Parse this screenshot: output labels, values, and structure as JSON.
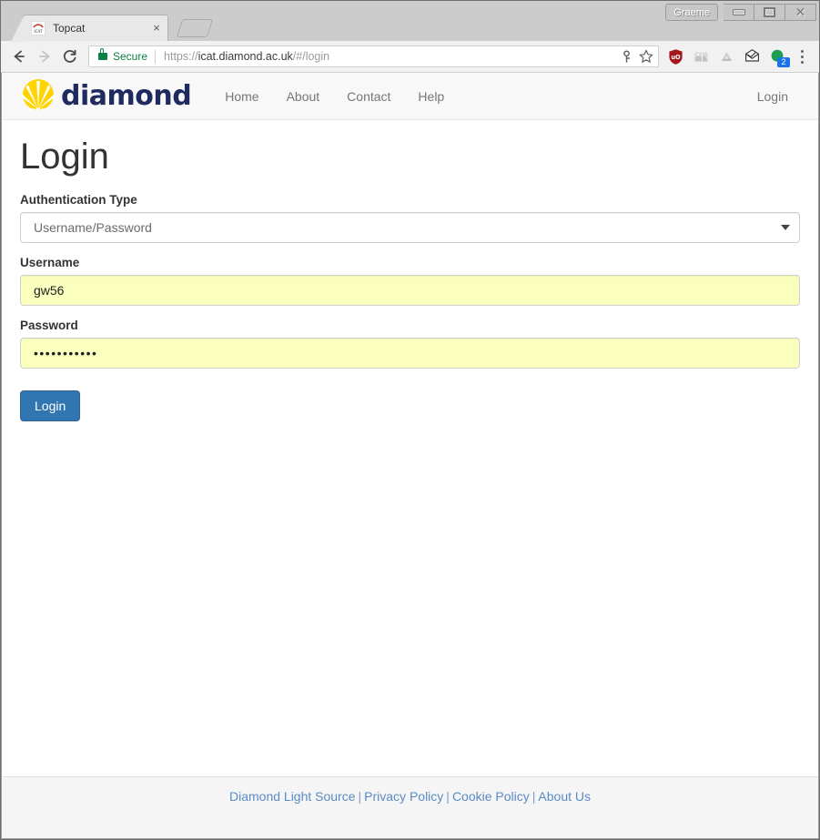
{
  "window": {
    "profile_label": "Graeme",
    "minimize_label": "Minimize",
    "maximize_label": "Maximize",
    "close_label": "Close"
  },
  "browser": {
    "tab": {
      "title": "Topcat",
      "favicon": "icat-favicon",
      "close_label": "×"
    },
    "new_tab_label": "New Tab",
    "back_label": "Back",
    "forward_label": "Forward",
    "reload_label": "Reload",
    "omnibox": {
      "security_text": "Secure",
      "url_scheme": "https://",
      "url_host": "icat.diamond.ac.uk",
      "url_path": "/#/login",
      "key_icon": "key-icon",
      "star_icon": "star-icon"
    },
    "extensions": [
      {
        "name": "ublock-origin-icon",
        "label": "uO"
      },
      {
        "name": "extension-icon",
        "label": ""
      },
      {
        "name": "google-drive-icon",
        "label": ""
      },
      {
        "name": "mail-icon",
        "label": ""
      },
      {
        "name": "profile-avatar-icon",
        "label": "",
        "badge": "2"
      }
    ],
    "menu_label": "Customize and control Google Chrome"
  },
  "site": {
    "brand": {
      "logo": "diamond-sunburst-logo",
      "word": "diamond"
    },
    "nav_links": [
      {
        "label": "Home"
      },
      {
        "label": "About"
      },
      {
        "label": "Contact"
      },
      {
        "label": "Help"
      }
    ],
    "nav_right": {
      "login_label": "Login"
    }
  },
  "login": {
    "title": "Login",
    "auth_type": {
      "label": "Authentication Type",
      "value": "Username/Password",
      "options": [
        "Username/Password"
      ]
    },
    "username": {
      "label": "Username",
      "value": "gw56",
      "placeholder": ""
    },
    "password": {
      "label": "Password",
      "value": "•••••••••••",
      "placeholder": ""
    },
    "submit_label": "Login"
  },
  "footer": {
    "links": [
      {
        "label": "Diamond Light Source"
      },
      {
        "label": "Privacy Policy"
      },
      {
        "label": "Cookie Policy"
      },
      {
        "label": "About Us"
      }
    ],
    "separator": "|"
  },
  "colors": {
    "brand_navy": "#1f2a5e",
    "brand_yellow": "#ffd400",
    "primary_button": "#3276b1",
    "secure_green": "#0b8043",
    "autofill_yellow": "#faffbd",
    "link_blue": "#5b8bc4"
  }
}
